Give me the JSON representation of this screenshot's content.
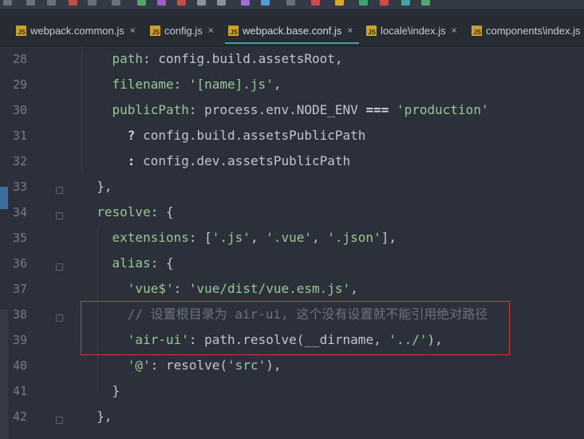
{
  "colors": {
    "background": "#2b303b",
    "tab_active_underline": "#3aa5a0",
    "highlight_box": "#d53a3a",
    "js_badge": "#c9a227"
  },
  "tabs": [
    {
      "label": "webpack.common.js",
      "icon": "js-file-icon",
      "close": "×"
    },
    {
      "label": "config.js",
      "icon": "js-file-icon",
      "close": "×"
    },
    {
      "label": "webpack.base.conf.js",
      "icon": "js-file-icon",
      "close": "×",
      "active": true
    },
    {
      "label": "locale\\index.js",
      "icon": "js-file-icon",
      "close": "×"
    },
    {
      "label": "components\\index.js",
      "icon": "js-file-icon",
      "close": "×"
    }
  ],
  "js_badge_text": "JS",
  "editor": {
    "line_numbers": [
      "28",
      "29",
      "30",
      "31",
      "32",
      "33",
      "34",
      "35",
      "36",
      "37",
      "38",
      "39",
      "40",
      "41",
      "42"
    ],
    "lines": [
      {
        "indent": "    ",
        "tokens": [
          {
            "t": "path",
            "c": "kw-prop"
          },
          {
            "t": ": ",
            "c": "plain"
          },
          {
            "t": "config",
            "c": "plain"
          },
          {
            "t": ".",
            "c": "punc"
          },
          {
            "t": "build",
            "c": "plain"
          },
          {
            "t": ".",
            "c": "punc"
          },
          {
            "t": "assetsRoot",
            "c": "plain"
          },
          {
            "t": ",",
            "c": "punc"
          }
        ]
      },
      {
        "indent": "    ",
        "tokens": [
          {
            "t": "filename",
            "c": "kw-prop"
          },
          {
            "t": ": ",
            "c": "plain"
          },
          {
            "t": "'[name].js'",
            "c": "str"
          },
          {
            "t": ",",
            "c": "punc"
          }
        ]
      },
      {
        "indent": "    ",
        "tokens": [
          {
            "t": "publicPath",
            "c": "kw-prop"
          },
          {
            "t": ": ",
            "c": "plain"
          },
          {
            "t": "process",
            "c": "plain"
          },
          {
            "t": ".",
            "c": "punc"
          },
          {
            "t": "env",
            "c": "plain"
          },
          {
            "t": ".",
            "c": "punc"
          },
          {
            "t": "NODE_ENV",
            "c": "plain"
          },
          {
            "t": " === ",
            "c": "tern"
          },
          {
            "t": "'production'",
            "c": "str"
          }
        ]
      },
      {
        "indent": "      ",
        "tokens": [
          {
            "t": "? ",
            "c": "tern"
          },
          {
            "t": "config",
            "c": "plain"
          },
          {
            "t": ".",
            "c": "punc"
          },
          {
            "t": "build",
            "c": "plain"
          },
          {
            "t": ".",
            "c": "punc"
          },
          {
            "t": "assetsPublicPath",
            "c": "plain"
          }
        ]
      },
      {
        "indent": "      ",
        "tokens": [
          {
            "t": ": ",
            "c": "tern"
          },
          {
            "t": "config",
            "c": "plain"
          },
          {
            "t": ".",
            "c": "punc"
          },
          {
            "t": "dev",
            "c": "plain"
          },
          {
            "t": ".",
            "c": "punc"
          },
          {
            "t": "assetsPublicPath",
            "c": "plain"
          }
        ]
      },
      {
        "indent": "  ",
        "tokens": [
          {
            "t": "},",
            "c": "punc"
          }
        ]
      },
      {
        "indent": "  ",
        "tokens": [
          {
            "t": "resolve",
            "c": "kw-prop"
          },
          {
            "t": ": {",
            "c": "plain"
          }
        ]
      },
      {
        "indent": "    ",
        "tokens": [
          {
            "t": "extensions",
            "c": "kw-prop"
          },
          {
            "t": ": [",
            "c": "plain"
          },
          {
            "t": "'.js'",
            "c": "str"
          },
          {
            "t": ", ",
            "c": "punc"
          },
          {
            "t": "'.vue'",
            "c": "str"
          },
          {
            "t": ", ",
            "c": "punc"
          },
          {
            "t": "'.json'",
            "c": "str"
          },
          {
            "t": "],",
            "c": "punc"
          }
        ]
      },
      {
        "indent": "    ",
        "tokens": [
          {
            "t": "alias",
            "c": "kw-prop"
          },
          {
            "t": ": {",
            "c": "plain"
          }
        ]
      },
      {
        "indent": "      ",
        "tokens": [
          {
            "t": "'vue$'",
            "c": "str"
          },
          {
            "t": ": ",
            "c": "plain"
          },
          {
            "t": "'vue/dist/vue.esm.js'",
            "c": "str"
          },
          {
            "t": ",",
            "c": "punc"
          }
        ]
      },
      {
        "indent": "      ",
        "tokens": [
          {
            "t": "// 设置根目录为 air-ui, 这个没有设置就不能引用绝对路径",
            "c": "cm"
          }
        ]
      },
      {
        "indent": "      ",
        "tokens": [
          {
            "t": "'air-ui'",
            "c": "str"
          },
          {
            "t": ": ",
            "c": "plain"
          },
          {
            "t": "path",
            "c": "plain"
          },
          {
            "t": ".",
            "c": "punc"
          },
          {
            "t": "resolve",
            "c": "plain"
          },
          {
            "t": "(",
            "c": "punc"
          },
          {
            "t": "__dirname",
            "c": "plain"
          },
          {
            "t": ", ",
            "c": "punc"
          },
          {
            "t": "'../'",
            "c": "str"
          },
          {
            "t": "),",
            "c": "punc"
          }
        ]
      },
      {
        "indent": "      ",
        "tokens": [
          {
            "t": "'@'",
            "c": "str"
          },
          {
            "t": ": ",
            "c": "plain"
          },
          {
            "t": "resolve",
            "c": "plain"
          },
          {
            "t": "(",
            "c": "punc"
          },
          {
            "t": "'src'",
            "c": "str"
          },
          {
            "t": "),",
            "c": "punc"
          }
        ]
      },
      {
        "indent": "    ",
        "tokens": [
          {
            "t": "}",
            "c": "punc"
          }
        ]
      },
      {
        "indent": "  ",
        "tokens": [
          {
            "t": "},",
            "c": "punc"
          }
        ]
      }
    ]
  }
}
